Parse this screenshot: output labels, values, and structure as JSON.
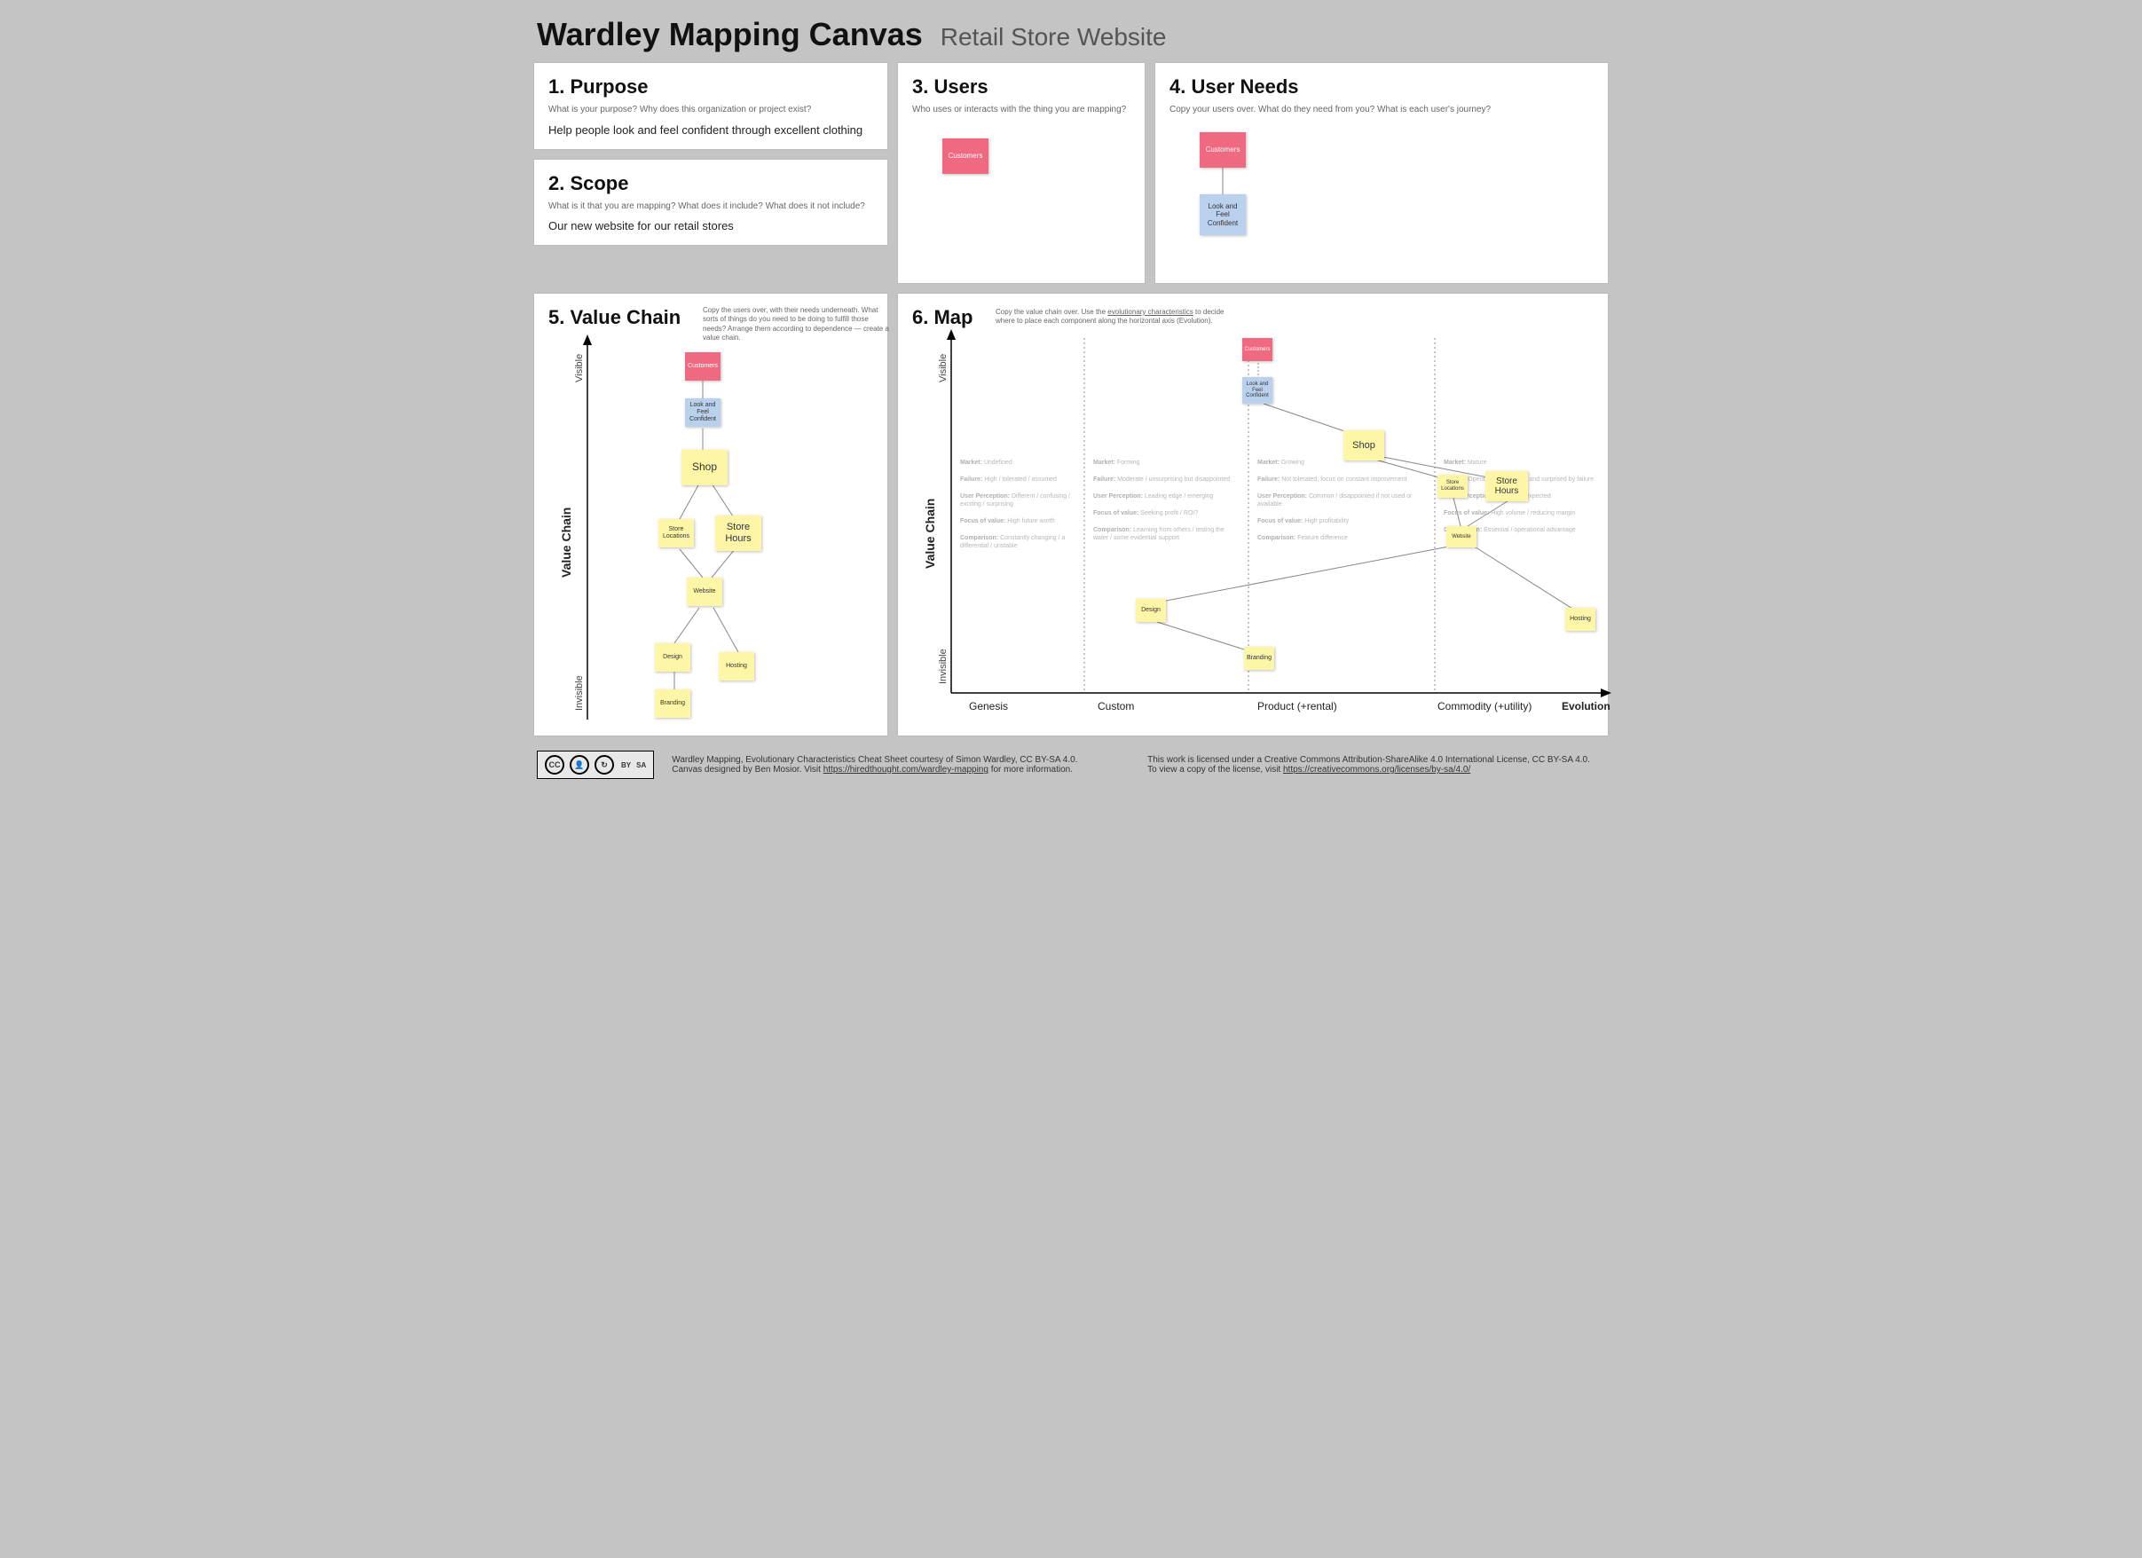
{
  "header": {
    "title": "Wardley Mapping Canvas",
    "subtitle": "Retail Store Website"
  },
  "p1": {
    "heading": "1. Purpose",
    "prompt": "What is your purpose? Why does this organization or project exist?",
    "content": "Help people look and feel confident through excellent clothing"
  },
  "p2": {
    "heading": "2. Scope",
    "prompt": "What is it that you are mapping? What does it include? What does it not include?",
    "content": "Our new website for our retail stores"
  },
  "p3": {
    "heading": "3. Users",
    "prompt": "Who uses or interacts with the thing you are mapping?",
    "sticky": "Customers"
  },
  "p4": {
    "heading": "4. User Needs",
    "prompt": "Copy your users over. What do they need from you? What is each user's journey?",
    "sticky1": "Customers",
    "sticky2": "Look and Feel Confident"
  },
  "p5": {
    "heading": "5. Value Chain",
    "instr": "Copy the users over, with their needs underneath. What sorts of things do you need to be doing to fulfill those needs? Arrange them according to dependence — create a value chain.",
    "axis": "Value Chain",
    "vis": "Visible",
    "inv": "Invisible",
    "nodes": {
      "customers": "Customers",
      "confident": "Look and Feel Confident",
      "shop": "Shop",
      "locations": "Store Locations",
      "hours": "Store Hours",
      "website": "Website",
      "design": "Design",
      "hosting": "Hosting",
      "branding": "Branding"
    }
  },
  "p6": {
    "heading": "6. Map",
    "instr_a": "Copy the value chain over. Use the ",
    "instr_link": "evolutionary characteristics",
    "instr_b": " to decide where to place each component along the horizontal axis (Evolution).",
    "axis": "Value Chain",
    "vis": "Visible",
    "inv": "Invisible",
    "evo": {
      "g": "Genesis",
      "c": "Custom",
      "p": "Product (+rental)",
      "m": "Commodity (+utility)",
      "x": "Evolution"
    },
    "nodes": {
      "customers": "Customers",
      "confident": "Look and Feel Confident",
      "shop": "Shop",
      "locations": "Store Locations",
      "hours": "Store Hours",
      "website": "Website",
      "design": "Design",
      "hosting": "Hosting",
      "branding": "Branding"
    },
    "notes": {
      "c1": {
        "m": "Market:",
        "mv": " Undefined",
        "f": "Failure:",
        "fv": " High / tolerated / assumed",
        "u": "User Perception:",
        "uv": " Different / confusing / exciting / surprising",
        "fo": "Focus of value:",
        "fov": " High future worth",
        "co": "Comparison:",
        "cov": " Constantly changing / a differential / unstable"
      },
      "c2": {
        "m": "Market:",
        "mv": " Forming",
        "f": "Failure:",
        "fv": " Moderate / unsurprising but disappointed",
        "u": "User Perception:",
        "uv": " Leading edge / emerging",
        "fo": "Focus of value:",
        "fov": " Seeking profit / ROI?",
        "co": "Comparison:",
        "cov": " Learning from others / testing the water / some evidential support"
      },
      "c3": {
        "m": "Market:",
        "mv": " Growing",
        "f": "Failure:",
        "fv": " Not tolerated, focus on constant improvement",
        "u": "User Perception:",
        "uv": " Common / disappointed if not used or available",
        "fo": "Focus of value:",
        "fov": " High profitability",
        "co": "Comparison:",
        "cov": " Feature difference"
      },
      "c4": {
        "m": "Market:",
        "mv": " Mature",
        "f": "Failure:",
        "fv": " Operational efficiency and surprised by failure",
        "u": "User Perception:",
        "uv": " Standard / expected",
        "fo": "Focus of value:",
        "fov": " High volume / reducing margin",
        "co": "Comparison:",
        "cov": " Essential / operational advantage"
      }
    }
  },
  "footer": {
    "cc": "CC",
    "by": "BY",
    "sa": "SA",
    "l1": "Wardley Mapping, Evolutionary Characteristics Cheat Sheet courtesy of Simon Wardley, CC BY-SA 4.0.",
    "l2a": "Canvas designed by Ben Mosior. Visit ",
    "l2link": "https://hiredthought.com/wardley-mapping",
    "l2b": " for more information.",
    "r1": "This work is licensed under a Creative Commons Attribution-ShareAlike 4.0 International License, CC BY-SA 4.0.",
    "r2a": "To view a copy of the license, visit ",
    "r2link": "https://creativecommons.org/licenses/by-sa/4.0/"
  }
}
